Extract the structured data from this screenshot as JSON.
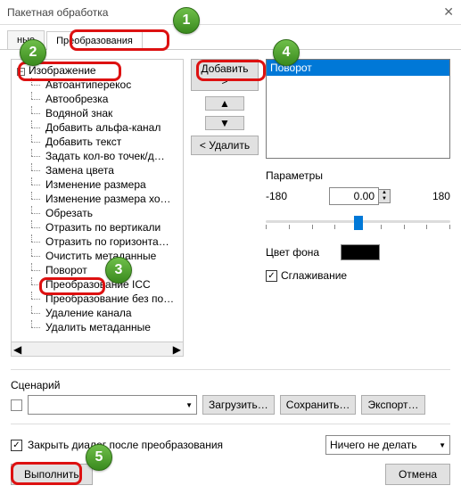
{
  "title": "Пакетная обработка",
  "tabs": {
    "t0": "ные",
    "t1": "Преобразования"
  },
  "tree": {
    "root": "Изображение",
    "items": {
      "i0": "Автоантиперекос",
      "i1": "Автообрезка",
      "i2": "Водяной знак",
      "i3": "Добавить альфа-канал",
      "i4": "Добавить текст",
      "i5": "Задать кол-во точек/д…",
      "i6": "Замена цвета",
      "i7": "Изменение размера",
      "i8": "Изменение размера хо…",
      "i9": "Обрезать",
      "i10": "Отразить по вертикали",
      "i11": "Отразить по горизонта…",
      "i12": "Очистить метаданные",
      "i13": "Поворот",
      "i14": "Преобразование ICC",
      "i15": "Преобразование без по…",
      "i16": "Удаление канала",
      "i17": "Удалить метаданные"
    }
  },
  "buttons": {
    "add": "Добавить >",
    "remove": "< Удалить",
    "load": "Загрузить…",
    "save": "Сохранить…",
    "export": "Экспорт…",
    "run": "Выполнить",
    "cancel": "Отмена"
  },
  "list": {
    "item0": "Поворот"
  },
  "params": {
    "title": "Параметры",
    "min": "-180",
    "val": "0.00",
    "max": "180",
    "bgcolor_label": "Цвет фона",
    "smooth_label": "Сглаживание"
  },
  "scenario": {
    "title": "Сценарий"
  },
  "bottom": {
    "close_label": "Закрыть диалог после преобразования",
    "afteraction": "Ничего не делать"
  },
  "callouts": {
    "c1": "1",
    "c2": "2",
    "c3": "3",
    "c4": "4",
    "c5": "5"
  }
}
